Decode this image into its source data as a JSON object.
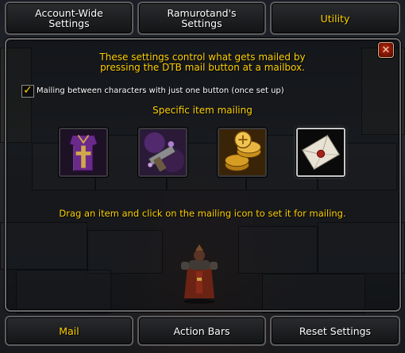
{
  "tabs": [
    {
      "label_line1": "Account-Wide",
      "label_line2": "Settings",
      "active": false
    },
    {
      "label_line1": "Ramurotand's",
      "label_line2": "Settings",
      "active": false
    },
    {
      "label_line1": "Utility",
      "label_line2": "",
      "active": true
    }
  ],
  "panel": {
    "description_line1": "These settings control what gets mailed by",
    "description_line2": "pressing the DTB mail button at a mailbox.",
    "checkbox": {
      "label": "Mailing between characters with just one button (once set up)",
      "checked": true
    },
    "section_title": "Specific item mailing",
    "item_slots": [
      {
        "icon": "purple-tabard-icon"
      },
      {
        "icon": "purple-tools-icon"
      },
      {
        "icon": "gold-coins-icon"
      },
      {
        "icon": "sealed-letter-icon",
        "selected": true
      }
    ],
    "hint": "Drag an item and click on the mailing icon to set it for mailing.",
    "close_icon": "close-x-icon"
  },
  "bottom_buttons": [
    {
      "label": "Mail",
      "active": true
    },
    {
      "label": "Action Bars",
      "active": false
    },
    {
      "label": "Reset Settings",
      "active": false
    }
  ],
  "colors": {
    "accent_gold": "#ffd100",
    "white_text": "#ffffff",
    "border_gray": "#5d5d5f"
  }
}
